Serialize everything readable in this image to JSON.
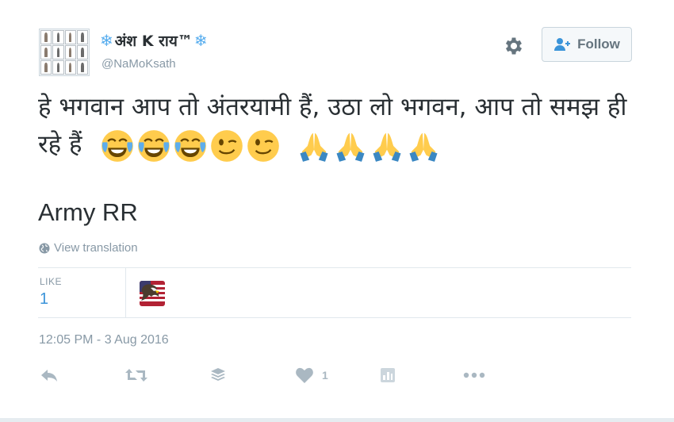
{
  "header": {
    "display_name_prefix": "❄",
    "display_name": "अंश K राय™",
    "display_name_suffix": "❄",
    "handle": "@NaMoKsath",
    "follow_label": "Follow"
  },
  "tweet": {
    "text": "हे भगवान आप तो अंतरयामी हैं, उठा लो भगवन, आप तो समझ ही रहे हैं",
    "emojis": [
      "tears-of-joy",
      "tears-of-joy",
      "tears-of-joy",
      "winking-face",
      "winking-face",
      "folded-hands",
      "folded-hands",
      "folded-hands",
      "folded-hands"
    ],
    "line2": "Army RR",
    "translate_label": "View translation"
  },
  "stats": {
    "like_label": "LIKE",
    "like_count": "1"
  },
  "timestamp": "12:05 PM - 3 Aug 2016",
  "actions": {
    "like_count": "1"
  },
  "colors": {
    "link_blue": "#3b94d9",
    "muted": "#8899a6",
    "icon_gray": "#aab8c2",
    "snow_blue": "#55acee"
  }
}
